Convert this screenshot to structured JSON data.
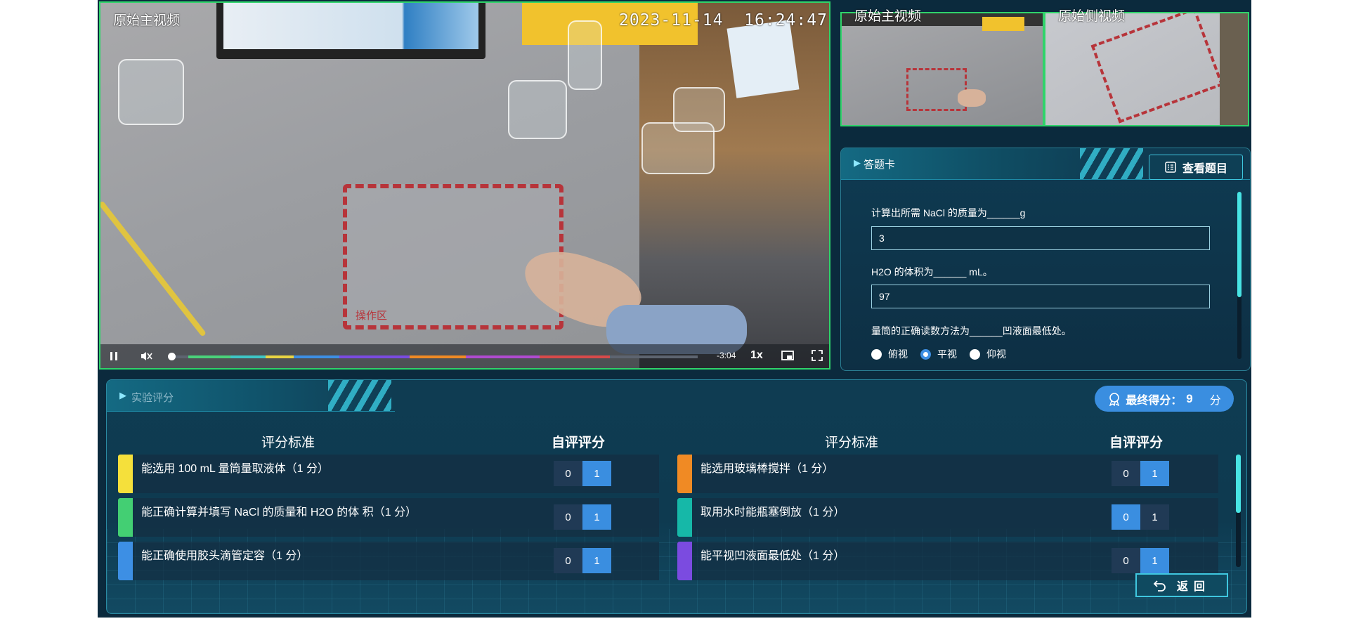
{
  "main_video": {
    "title": "原始主视频",
    "timestamp": "2023-11-14  16:24:47",
    "work_area_label": "操作区",
    "time_remaining": "-3:04",
    "speed": "1x",
    "progress_segments": [
      {
        "color": "#4ad27a"
      },
      {
        "color": "#3ec6c6"
      },
      {
        "color": "#e8d443"
      },
      {
        "color": "#3d8fe4"
      },
      {
        "color": "#7a4be0"
      },
      {
        "color": "#f08a24"
      },
      {
        "color": "#b04bd0"
      },
      {
        "color": "#d84a4a"
      }
    ]
  },
  "side_videos": [
    {
      "title": "原始主视频"
    },
    {
      "title": "原始侧视频"
    }
  ],
  "answer_card": {
    "title": "答题卡",
    "view_button": "查看题目",
    "questions": [
      {
        "label": "计算出所需 NaCl 的质量为______g",
        "value": "3"
      },
      {
        "label": "H2O 的体积为______ mL。",
        "value": "97"
      },
      {
        "label": "量筒的正确读数方法为______凹液面最低处。"
      }
    ],
    "options": [
      "俯视",
      "平视",
      "仰视"
    ],
    "selected_option": "平视"
  },
  "evaluation": {
    "title": "实验评分",
    "final_score_label": "最终得分：",
    "final_score_value": "9",
    "final_score_unit": "分",
    "col_criteria": "评分标准",
    "col_self": "自评评分",
    "left_items": [
      {
        "text": "能选用 100 mL 量筒量取液体（1 分）",
        "color": "#f5e03b",
        "options": [
          "0",
          "1"
        ],
        "selected": "1"
      },
      {
        "text": "能正确计算并填写 NaCl 的质量和 H2O 的体 积（1 分）",
        "color": "#43cf73",
        "options": [
          "0",
          "1"
        ],
        "selected": "1"
      },
      {
        "text": "能正确使用胶头滴管定容（1 分）",
        "color": "#3d8fe4",
        "options": [
          "0",
          "1"
        ],
        "selected": "1"
      }
    ],
    "right_items": [
      {
        "text": "能选用玻璃棒搅拌（1 分）",
        "color": "#f08a24",
        "options": [
          "0",
          "1"
        ],
        "selected": "1"
      },
      {
        "text": "取用水时能瓶塞倒放（1 分）",
        "color": "#16b8a8",
        "options": [
          "0",
          "1"
        ],
        "selected": "0"
      },
      {
        "text": "能平视凹液面最低处（1 分）",
        "color": "#7b4be0",
        "options": [
          "0",
          "1"
        ],
        "selected": "1"
      }
    ],
    "back_button": "返回"
  }
}
